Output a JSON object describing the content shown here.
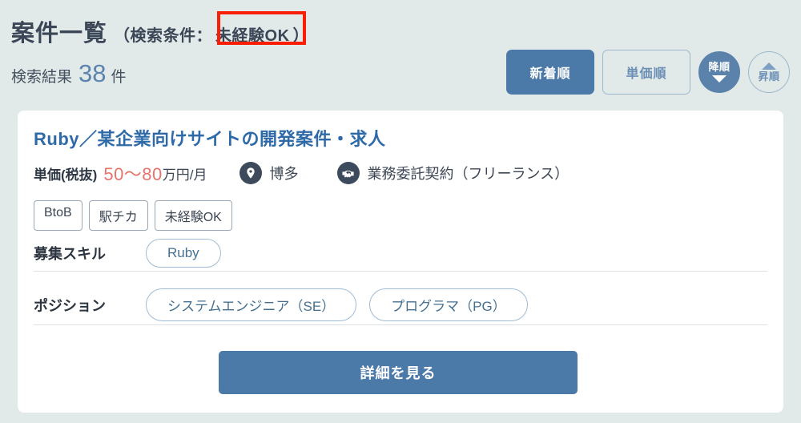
{
  "header": {
    "title": "案件一覧",
    "condition_prefix": "（検索条件：",
    "condition_value": "未経験OK",
    "condition_suffix": "）",
    "result_label": "検索結果",
    "result_count": "38",
    "result_unit": "件",
    "highlight_color": "#fa1e05"
  },
  "sort": {
    "newest_label": "新着順",
    "price_label": "単価順",
    "desc_label": "降順",
    "asc_label": "昇順",
    "active_color": "#4b79a8"
  },
  "card": {
    "title": "Ruby／某企業向けサイトの開発案件・求人",
    "price_label": "単価(税抜)",
    "price_value": "50〜80",
    "price_unit": "万円/月",
    "price_color": "#e8736a",
    "location_icon": "map-pin-icon",
    "location": "博多",
    "contract_icon": "handshake-icon",
    "contract": "業務委託契約（フリーランス）",
    "tags": [
      "BtoB",
      "駅チカ",
      "未経験OK"
    ],
    "skills_label": "募集スキル",
    "skills": [
      "Ruby"
    ],
    "positions_label": "ポジション",
    "positions": [
      "システムエンジニア（SE）",
      "プログラマ（PG）"
    ],
    "detail_button": "詳細を見る"
  }
}
